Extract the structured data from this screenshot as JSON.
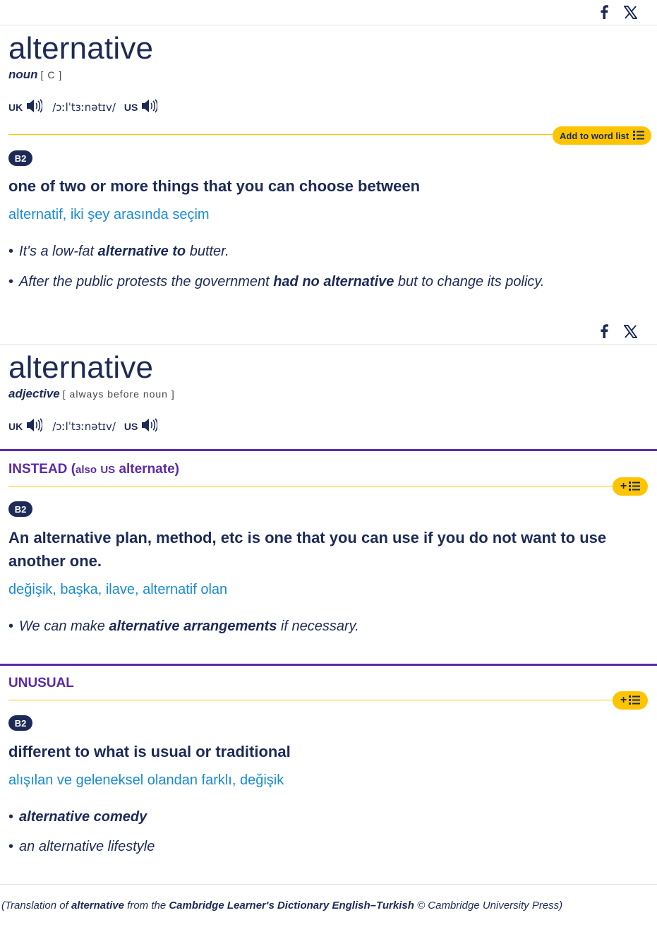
{
  "entries": [
    {
      "headword": "alternative",
      "pos": "noun",
      "grammar": "[ C ]",
      "uk_label": "UK",
      "us_label": "US",
      "ipa": "/ɔːlˈtɜːnətɪv/",
      "word_list_label": "Add to word list",
      "senses": [
        {
          "level": "B2",
          "definition": "one of two or more things that you can choose between",
          "translation": "alternatif, iki şey arasında seçim",
          "examples": [
            {
              "pre": "It's a low-fat ",
              "bold": "alternative to",
              "post": " butter."
            },
            {
              "pre": "After the public protests the government ",
              "bold": "had no alternative",
              "post": " but to change its policy."
            }
          ]
        }
      ]
    },
    {
      "headword": "alternative",
      "pos": "adjective",
      "grammar": "[ always before noun ]",
      "uk_label": "UK",
      "us_label": "US",
      "ipa": "/ɔːlˈtɜːnətɪv/",
      "senses": [
        {
          "guideword": "INSTEAD",
          "guide_open": "(",
          "guide_also": "also",
          "guide_us": "US",
          "guide_variant": "alternate",
          "guide_close": ")",
          "level": "B2",
          "definition": "An alternative plan, method, etc is one that you can use if you do not want to use another one.",
          "translation": "değişik, başka, ilave, alternatif olan",
          "examples": [
            {
              "pre": "We can make ",
              "bold": "alternative arrangements",
              "post": " if necessary."
            }
          ]
        },
        {
          "guideword": "UNUSUAL",
          "level": "B2",
          "definition": "different to what is usual or traditional",
          "translation": "alışılan ve geleneksel olandan farklı, değişik",
          "examples": [
            {
              "pre": "",
              "bold": "alternative comedy",
              "post": ""
            },
            {
              "pre": "an alternative lifestyle",
              "bold": "",
              "post": ""
            }
          ]
        }
      ]
    }
  ],
  "footer": {
    "open": "(Translation of ",
    "word": "alternative",
    "mid": " from the ",
    "source": "Cambridge Learner's Dictionary English–Turkish",
    "close": " © Cambridge University Press)"
  },
  "icons": {
    "facebook": "facebook-icon",
    "x": "x-twitter-icon",
    "speaker": "speaker-icon",
    "list": "list-icon"
  },
  "colors": {
    "navy": "#1d2a57",
    "translation_blue": "#1a8ad4",
    "guide_purple": "#5b2aa6",
    "wordlist_yellow": "#fec400"
  }
}
